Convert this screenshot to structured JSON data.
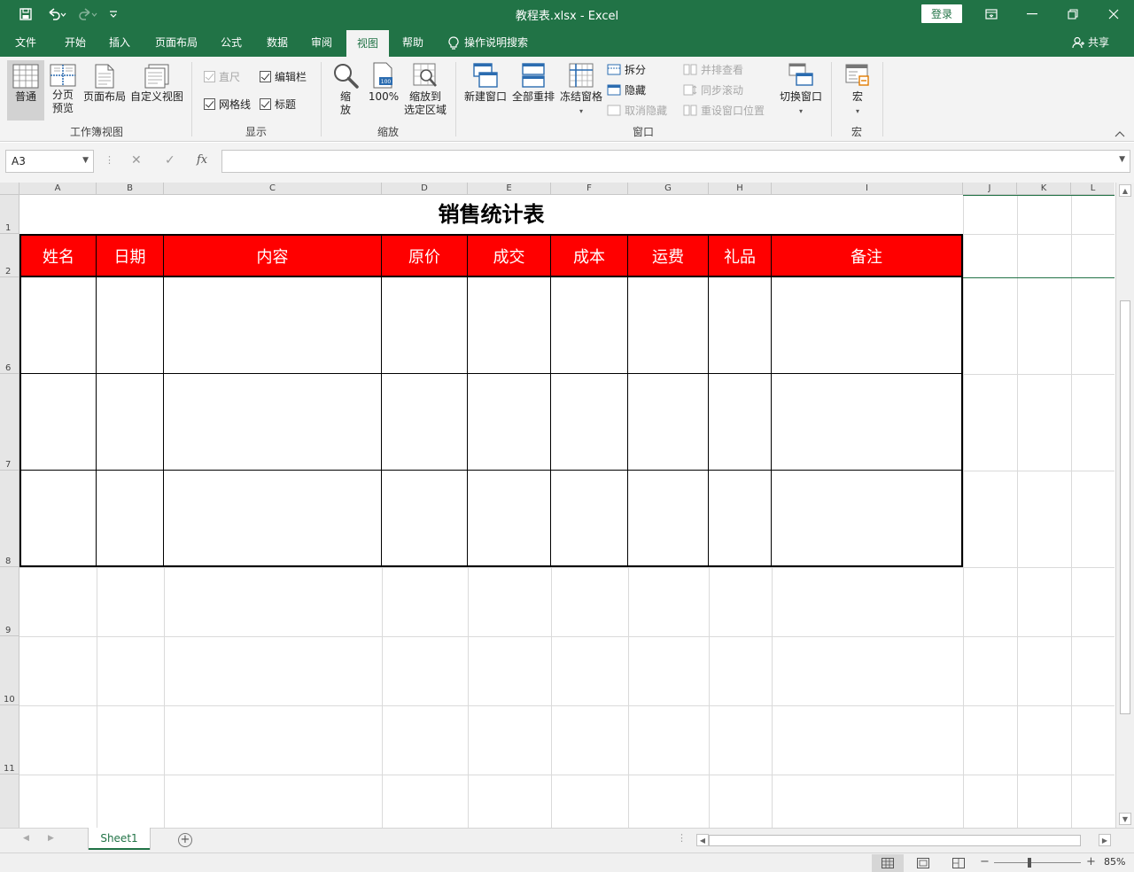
{
  "window": {
    "title": "教程表.xlsx  -  Excel",
    "login_label": "登录"
  },
  "tabs": [
    "文件",
    "开始",
    "插入",
    "页面布局",
    "公式",
    "数据",
    "审阅",
    "视图",
    "帮助"
  ],
  "tell_me": "操作说明搜索",
  "share": "共享",
  "ribbon": {
    "workbook_views": {
      "label": "工作簿视图",
      "normal": "普通",
      "page_break_1": "分页",
      "page_break_2": "预览",
      "page_layout": "页面布局",
      "custom_views": "自定义视图"
    },
    "show": {
      "label": "显示",
      "ruler": "直尺",
      "formula_bar": "编辑栏",
      "gridlines": "网格线",
      "headings": "标题"
    },
    "zoom": {
      "label": "缩放",
      "zoom_1": "缩",
      "zoom_2": "放",
      "hundred": "100%",
      "to_selection_1": "缩放到",
      "to_selection_2": "选定区域"
    },
    "window": {
      "label": "窗口",
      "new_window": "新建窗口",
      "arrange_all": "全部重排",
      "freeze_panes": "冻结窗格",
      "split": "拆分",
      "hide": "隐藏",
      "unhide": "取消隐藏",
      "side_by_side": "并排查看",
      "sync_scroll": "同步滚动",
      "reset_position": "重设窗口位置",
      "switch_windows": "切换窗口"
    },
    "macros": {
      "label": "宏",
      "macros": "宏"
    }
  },
  "formula_bar": {
    "name_box": "A3",
    "fx": "fx",
    "content": ""
  },
  "columns": [
    "A",
    "B",
    "C",
    "D",
    "E",
    "F",
    "G",
    "H",
    "I",
    "J",
    "K",
    "L"
  ],
  "rows": [
    "1",
    "2",
    "6",
    "7",
    "8",
    "9",
    "10",
    "11"
  ],
  "sheet": {
    "title": "销售统计表",
    "headers": [
      "姓名",
      "日期",
      "内容",
      "原价",
      "成交",
      "成本",
      "运费",
      "礼品",
      "备注"
    ]
  },
  "sheet_tabs": {
    "active": "Sheet1"
  },
  "status": {
    "zoom": "85%"
  },
  "colors": {
    "excel_green": "#217346",
    "header_fill": "#ff0000",
    "header_text": "#ffffff"
  }
}
